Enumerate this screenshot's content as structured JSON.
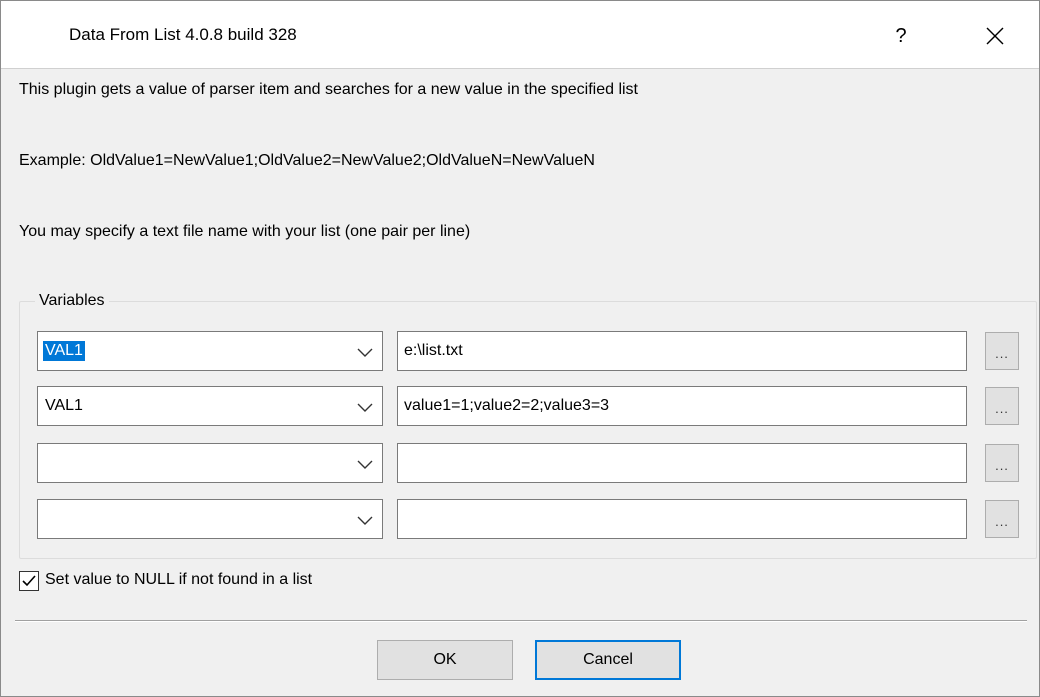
{
  "window": {
    "title": "Data From List 4.0.8 build 328",
    "help_label": "?"
  },
  "info": {
    "line1": "This plugin gets a value of parser item and searches for a new value in the specified list",
    "line2": "Example: OldValue1=NewValue1;OldValue2=NewValue2;OldValueN=NewValueN",
    "line3": "You may specify a text file name with your list (one pair per line)"
  },
  "variables": {
    "group_label": "Variables",
    "rows": [
      {
        "variable": "VAL1",
        "value": "e:\\list.txt",
        "browse_label": "..."
      },
      {
        "variable": "VAL1",
        "value": "value1=1;value2=2;value3=3",
        "browse_label": "..."
      },
      {
        "variable": "",
        "value": "",
        "browse_label": "..."
      },
      {
        "variable": "",
        "value": "",
        "browse_label": "..."
      }
    ]
  },
  "null_option": {
    "label": "Set value to NULL if not found in a list",
    "checked": true
  },
  "buttons": {
    "ok": "OK",
    "cancel": "Cancel"
  },
  "colors": {
    "accent": "#0078d7",
    "dialog_background": "#f0f0f0"
  }
}
